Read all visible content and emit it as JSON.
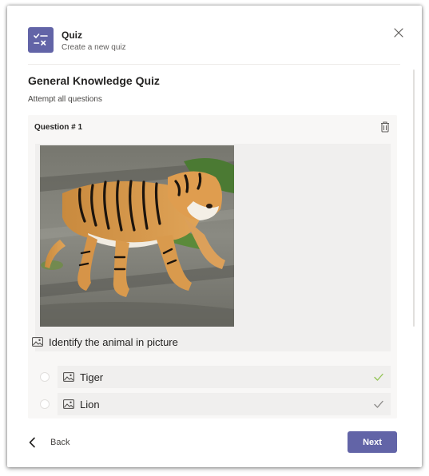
{
  "header": {
    "app_title": "Quiz",
    "app_subtitle": "Create a new quiz",
    "icon": "quiz-app-icon",
    "close_icon": "close-icon"
  },
  "quiz": {
    "title": "General Knowledge Quiz",
    "subtitle": "Attempt all questions"
  },
  "question": {
    "label": "Question # 1",
    "text": "Identify the animal in picture",
    "image": "tiger-photo",
    "delete_icon": "trash-icon",
    "options": [
      {
        "label": "Tiger",
        "check_color": "#92c353"
      },
      {
        "label": "Lion",
        "check_color": "#8a8886"
      }
    ]
  },
  "footer": {
    "back_label": "Back",
    "next_label": "Next"
  },
  "colors": {
    "accent": "#6264a7",
    "correct": "#92c353",
    "neutral_check": "#8a8886"
  }
}
